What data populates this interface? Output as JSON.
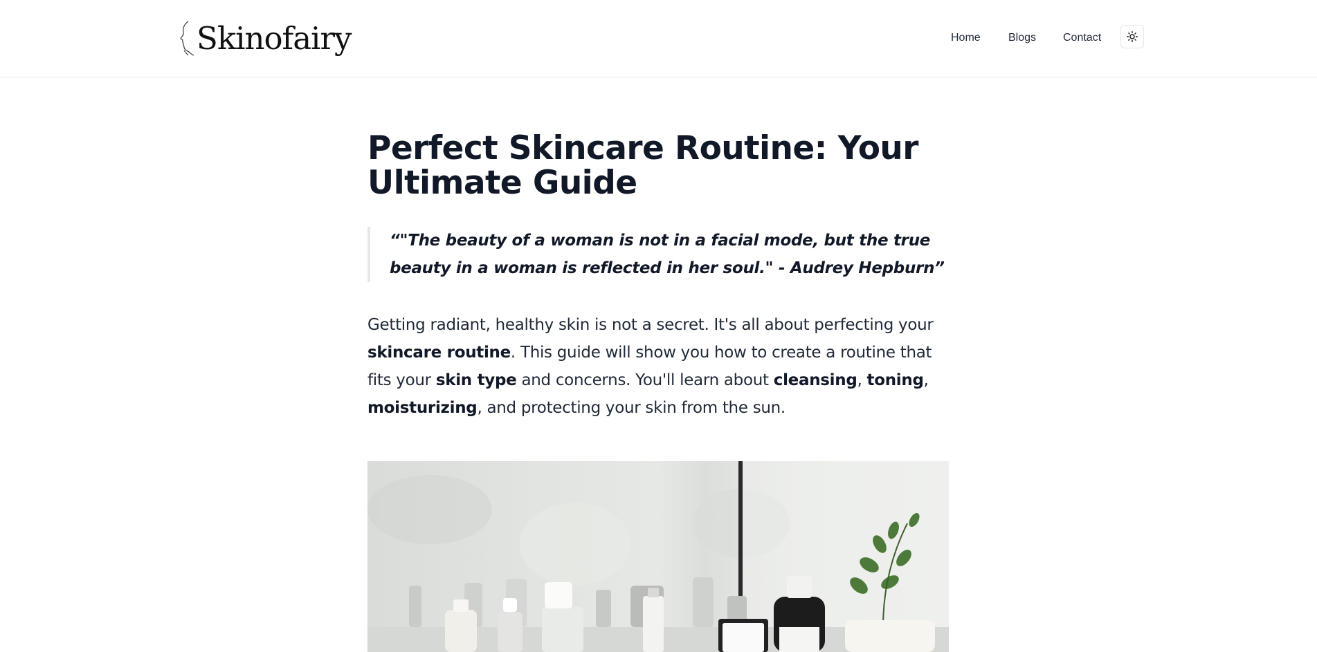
{
  "site": {
    "logo_text": "Skinofairy"
  },
  "nav": {
    "home": "Home",
    "blogs": "Blogs",
    "contact": "Contact",
    "theme_toggle_icon": "sun-icon"
  },
  "article": {
    "title": "Perfect Skincare Routine: Your Ultimate Guide",
    "quote": "“\"The beauty of a woman is not in a facial mode, but the true beauty in a woman is reflected in her soul.\" - Audrey Hepburn”",
    "intro": {
      "p1": "Getting radiant, healthy skin is not a secret. It's all about perfecting your ",
      "b1": "skincare routine",
      "p2": ". This guide will show you how to create a routine that fits your ",
      "b2": "skin type",
      "p3": " and concerns. You'll learn about ",
      "b3": "cleansing",
      "p4": ", ",
      "b4": "toning",
      "p5": ", ",
      "b5": "moisturizing",
      "p6": ", and protecting your skin from the sun."
    },
    "hero_image_alt": "skincare-products-on-bathroom-shelf"
  },
  "colors": {
    "text": "#111827",
    "border": "#e5e7eb",
    "background": "#ffffff"
  }
}
